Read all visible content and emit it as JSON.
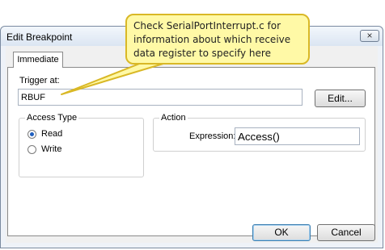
{
  "window": {
    "title": "Edit Breakpoint",
    "close_glyph": "×"
  },
  "tabs": [
    {
      "label": "Immediate"
    }
  ],
  "trigger": {
    "label": "Trigger at:",
    "value": "RBUF",
    "edit_button": "Edit..."
  },
  "access_type": {
    "legend": "Access Type",
    "options": [
      {
        "label": "Read",
        "checked": true
      },
      {
        "label": "Write",
        "checked": false
      }
    ]
  },
  "action": {
    "legend": "Action",
    "expression_label": "Expression:",
    "expression_value": "Access()"
  },
  "buttons": {
    "ok": "OK",
    "cancel": "Cancel"
  },
  "callout": {
    "lines": [
      "Check SerialPortInterrupt.c  for",
      "information about which receive",
      "data register to specify here"
    ]
  }
}
